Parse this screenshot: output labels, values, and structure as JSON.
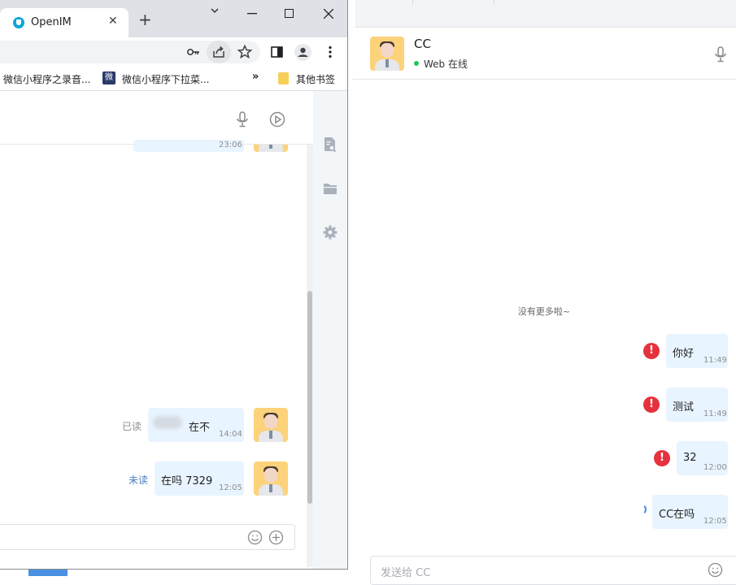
{
  "browser": {
    "tab_title": "OpenIM",
    "tab_close": "✕",
    "new_tab": "+",
    "bookmarks": [
      {
        "label": "微信小程序之录音..."
      },
      {
        "label": "微信小程序下拉菜..."
      },
      {
        "label": "其他书签"
      }
    ],
    "bookmarks_more": "»"
  },
  "left_chat": {
    "messages": [
      {
        "text": "",
        "time": "23:06",
        "status": ""
      },
      {
        "text": "在不",
        "time": "14:04",
        "status": "已读"
      },
      {
        "text": "在吗 7329",
        "time": "12:05",
        "status": "未读"
      }
    ]
  },
  "right_chat": {
    "contact_name": "CC",
    "online_status": "Web 在线",
    "no_more": "没有更多啦~",
    "messages": [
      {
        "text": "你好",
        "time": "11:49",
        "status": "failed"
      },
      {
        "text": "测试",
        "time": "11:49",
        "status": "failed"
      },
      {
        "text": "32",
        "time": "12:00",
        "status": "failed"
      },
      {
        "text": "CC在吗",
        "time": "12:05",
        "status": "sending"
      }
    ],
    "input_placeholder": "发送给 CC",
    "error_glyph": "!"
  },
  "colors": {
    "bubble": "#e8f4ff",
    "error": "#e5323e",
    "online": "#22c55e",
    "unread": "#4a7fc1"
  }
}
